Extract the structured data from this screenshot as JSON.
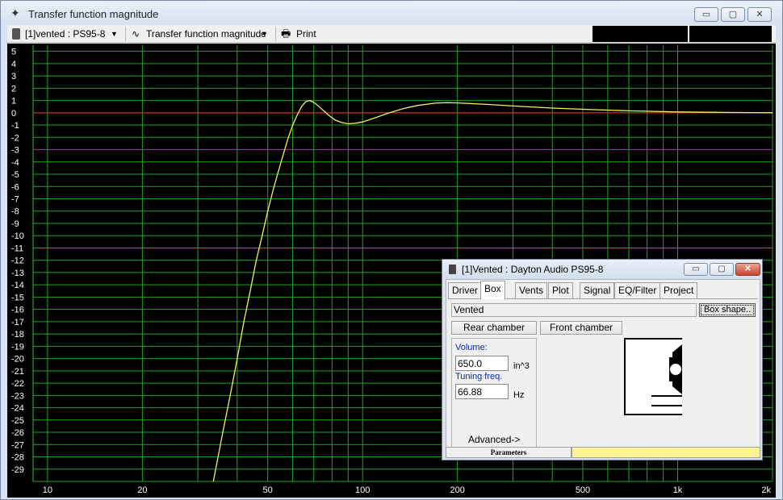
{
  "window": {
    "title": "Transfer function magnitude",
    "min": "▭",
    "max": "▢",
    "close": "✕"
  },
  "toolbar": {
    "driver": "[1]vented : PS95-8",
    "graph": "Transfer function magnitude",
    "print": "Print",
    "dropdown_arrow": "▼",
    "graph_icon": "∿",
    "print_icon": "🖶"
  },
  "chart_data": {
    "type": "line",
    "title": "",
    "xlabel": "",
    "ylabel": "",
    "x_scale": "log",
    "xlim": [
      9,
      2000
    ],
    "ylim": [
      -30,
      5.5
    ],
    "y_ticks": [
      5,
      4,
      3,
      2,
      1,
      0,
      -1,
      -2,
      -3,
      -4,
      -5,
      -6,
      -7,
      -8,
      -9,
      -10,
      -11,
      -12,
      -13,
      -14,
      -15,
      -16,
      -17,
      -18,
      -19,
      -20,
      -21,
      -22,
      -23,
      -24,
      -25,
      -26,
      -27,
      -28,
      -29
    ],
    "x_ticks": [
      {
        "value": 10,
        "label": "10"
      },
      {
        "value": 20,
        "label": "20"
      },
      {
        "value": 50,
        "label": "50"
      },
      {
        "value": 100,
        "label": "100"
      },
      {
        "value": 200,
        "label": "200"
      },
      {
        "value": 500,
        "label": "500"
      },
      {
        "value": 1000,
        "label": "1k"
      },
      {
        "value": 2000,
        "label": "2k"
      }
    ],
    "grid": true,
    "reference_lines": [
      {
        "y": 0,
        "color": "#e02020"
      },
      {
        "y": -3,
        "color": "#a02a8a"
      }
    ],
    "series": [
      {
        "color": "#f2f25a",
        "points": [
          [
            33.6,
            -30
          ],
          [
            36,
            -26
          ],
          [
            38,
            -23
          ],
          [
            40,
            -20
          ],
          [
            42,
            -17
          ],
          [
            44,
            -14.5
          ],
          [
            46,
            -12
          ],
          [
            48,
            -10
          ],
          [
            50,
            -8
          ],
          [
            52,
            -6.3
          ],
          [
            54,
            -4.8
          ],
          [
            56,
            -3.4
          ],
          [
            58,
            -2.1
          ],
          [
            60,
            -1
          ],
          [
            62,
            -0.2
          ],
          [
            64,
            0.5
          ],
          [
            66,
            0.9
          ],
          [
            68,
            1.0
          ],
          [
            70,
            0.85
          ],
          [
            72,
            0.6
          ],
          [
            75,
            0.2
          ],
          [
            78,
            -0.2
          ],
          [
            82,
            -0.6
          ],
          [
            86,
            -0.8
          ],
          [
            90,
            -0.9
          ],
          [
            95,
            -0.85
          ],
          [
            100,
            -0.75
          ],
          [
            110,
            -0.4
          ],
          [
            120,
            -0.05
          ],
          [
            135,
            0.35
          ],
          [
            150,
            0.6
          ],
          [
            170,
            0.78
          ],
          [
            185,
            0.82
          ],
          [
            200,
            0.8
          ],
          [
            250,
            0.68
          ],
          [
            300,
            0.55
          ],
          [
            400,
            0.38
          ],
          [
            500,
            0.28
          ],
          [
            700,
            0.16
          ],
          [
            1000,
            0.07
          ],
          [
            1500,
            0.02
          ],
          [
            2000,
            0.0
          ]
        ]
      }
    ]
  },
  "dialog": {
    "title": "[1]Vented : Dayton Audio PS95-8",
    "min": "▭",
    "max": "▢",
    "close": "✕",
    "tabs": [
      "Driver",
      "Box",
      "Vents",
      "Plot",
      "Signal",
      "EQ/Filter",
      "Project"
    ],
    "active_tab": "Box",
    "box_type": "Vented",
    "box_shape_button": "Box shape..",
    "rear_chamber": "Rear chamber",
    "front_chamber": "Front chamber",
    "volume_label": "Volume:",
    "volume_value": "650.0",
    "volume_unit": "in^3",
    "tuning_label": "Tuning freq.",
    "tuning_value": "66.88",
    "tuning_unit": "Hz",
    "advanced": "Advanced->",
    "status_left": "Parameters"
  }
}
